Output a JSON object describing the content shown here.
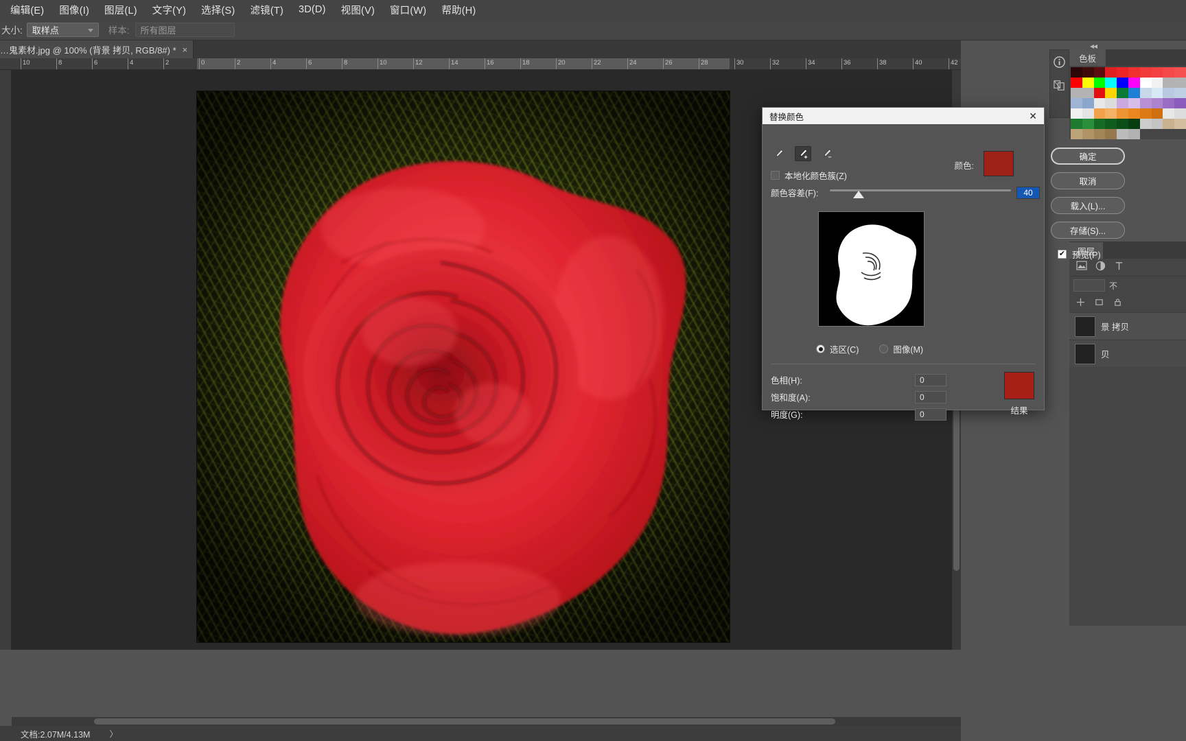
{
  "app": {
    "name": "Adobe Photoshop",
    "menus": [
      {
        "label": "编辑(E)"
      },
      {
        "label": "图像(I)"
      },
      {
        "label": "图层(L)"
      },
      {
        "label": "文字(Y)"
      },
      {
        "label": "选择(S)"
      },
      {
        "label": "滤镜(T)"
      },
      {
        "label": "3D(D)"
      },
      {
        "label": "视图(V)"
      },
      {
        "label": "窗口(W)"
      },
      {
        "label": "帮助(H)"
      }
    ]
  },
  "options_bar": {
    "size_label": "大小:",
    "size_value": "取样点",
    "sample_label": "样本:",
    "sample_value": "所有图层"
  },
  "document": {
    "tab_title": "…鬼素材.jpg @ 100% (背景 拷贝, RGB/8#) *",
    "close_glyph": "×",
    "zoom": "100%",
    "status": "文档:2.07M/4.13M",
    "status_arrow": "〉"
  },
  "rulers": {
    "h_ticks": [
      "10",
      "8",
      "6",
      "4",
      "2",
      "0",
      "2",
      "4",
      "6",
      "8",
      "10",
      "12",
      "14",
      "16",
      "18",
      "20",
      "22",
      "24",
      "26",
      "28",
      "30",
      "32",
      "34",
      "36",
      "38",
      "40",
      "42"
    ]
  },
  "dialog": {
    "title": "替换颜色",
    "close_glyph": "✕",
    "eyedroppers": [
      {
        "name": "eyedropper",
        "selected": false
      },
      {
        "name": "eyedropper-add",
        "selected": true
      },
      {
        "name": "eyedropper-subtract",
        "selected": false
      }
    ],
    "localized_clusters_label": "本地化颜色簇(Z)",
    "localized_clusters_checked": false,
    "fuzziness_label": "颜色容差(F):",
    "fuzziness_value": "40",
    "fuzziness_pos_pct": 16,
    "color_label": "颜色:",
    "color_swatch_hex": "#9e2017",
    "display_mode": {
      "selection_label": "选区(C)",
      "image_label": "图像(M)",
      "selected": "selection"
    },
    "adjustments": [
      {
        "label": "色相(H):",
        "value": "0",
        "pos_pct": 50
      },
      {
        "label": "饱和度(A):",
        "value": "0",
        "pos_pct": 50
      },
      {
        "label": "明度(G):",
        "value": "0",
        "pos_pct": 50
      }
    ],
    "result_label": "结果",
    "result_swatch_hex": "#a81f18",
    "buttons": [
      {
        "label": "确定",
        "primary": true
      },
      {
        "label": "取消",
        "primary": false
      },
      {
        "label": "载入(L)...",
        "primary": false
      },
      {
        "label": "存储(S)...",
        "primary": false
      }
    ],
    "preview_label": "预览(P)",
    "preview_checked": true
  },
  "right_dock": {
    "collapse_glyph": "◂◂",
    "rail_icons": [
      "info-icon",
      "clone-source-icon"
    ],
    "swatches_tab": "色板",
    "swatch_colors": [
      "#2b0707",
      "#3f0a0a",
      "#5c0d0d",
      "#e02020",
      "#ee2424",
      "#f03030",
      "#f23a3a",
      "#f44040",
      "#f54848",
      "#f65050",
      "#ff0000",
      "#ffff00",
      "#00ff00",
      "#00ffff",
      "#0000ff",
      "#ff00ff",
      "#ffffff",
      "#f2f2f2",
      "#b3b3b3",
      "#b3b3b3",
      "#b3b3b3",
      "#b3b3b3",
      "#e01010",
      "#ffd400",
      "#0a7a36",
      "#1f7fd6",
      "#c8d8e8",
      "#d8e8f4",
      "#b9c9e0",
      "#c0cfe4",
      "#9fb4d4",
      "#8aa6cc",
      "#e8e8e8",
      "#dcdcdc",
      "#caa8e0",
      "#d7bdea",
      "#b890d6",
      "#ad83cf",
      "#9a6cc4",
      "#8b5cbb",
      "#f0f0f0",
      "#e4e4e4",
      "#f2a24a",
      "#f5b265",
      "#ef9434",
      "#eb8720",
      "#dc7a15",
      "#cf700f",
      "#e8e8e8",
      "#dddddd",
      "#1e7a2e",
      "#2a8f3a",
      "#156b24",
      "#0f5c1d",
      "#0a4d17",
      "#063e11",
      "#cccccc",
      "#c4c4c4",
      "#c8b18e",
      "#d3bfa0",
      "#bda378",
      "#b09468",
      "#a28659",
      "#95784b",
      "#bbbbbb",
      "#b2b2b2"
    ],
    "layers_tab": "图层",
    "layers_opacity_prefix": "不",
    "layer_name": "景 拷贝",
    "layer_name_tail": "贝"
  }
}
